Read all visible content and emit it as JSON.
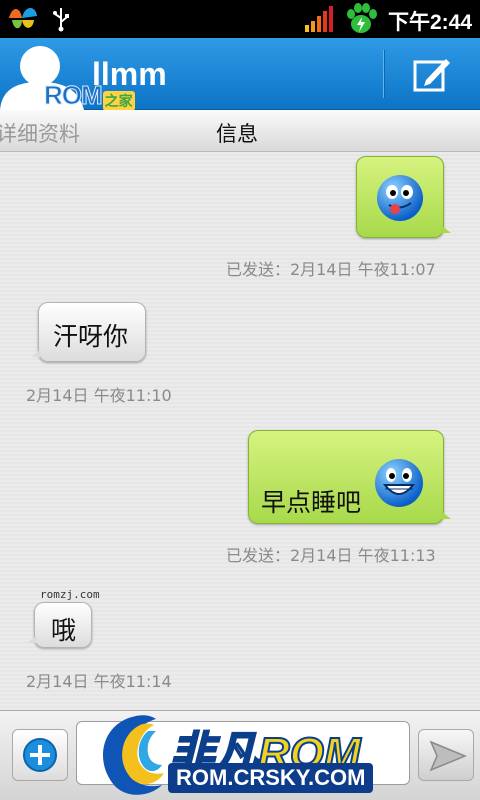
{
  "status_bar": {
    "time": "下午2:44",
    "icons": [
      "msn-butterfly-icon",
      "usb-icon",
      "signal-bars-icon",
      "baidu-paw-icon",
      "battery-charging-icon"
    ]
  },
  "header": {
    "contact_name": "llmm",
    "logo_text": "ROM",
    "logo_text_cn": "之家",
    "compose_icon": "compose-icon"
  },
  "tabs": {
    "details": "详细资料",
    "messages": "信息"
  },
  "messages": [
    {
      "direction": "out",
      "text": "",
      "emoji": "tongue-smiley",
      "meta": "已发送：2月14日 午夜11:07"
    },
    {
      "direction": "in",
      "text": "汗呀你",
      "meta": "2月14日 午夜11:10"
    },
    {
      "direction": "out",
      "text": "早点睡吧",
      "emoji": "grin-smiley",
      "meta": "已发送：2月14日 午夜11:13"
    },
    {
      "direction": "in",
      "text": "哦",
      "meta": "2月14日 午夜11:14"
    }
  ],
  "watermark_small": "romzj.com",
  "bottom_bar": {
    "add_icon": "plus-circle-icon",
    "send_icon": "send-arrow-icon",
    "brand_cn": "非凡",
    "brand_rom": "ROM",
    "brand_url": "ROM.CRSKY.COM"
  },
  "colors": {
    "header_blue": "#1a84d6",
    "outgoing_bubble": "#b9e35f",
    "incoming_bubble": "#f0f0f0"
  }
}
